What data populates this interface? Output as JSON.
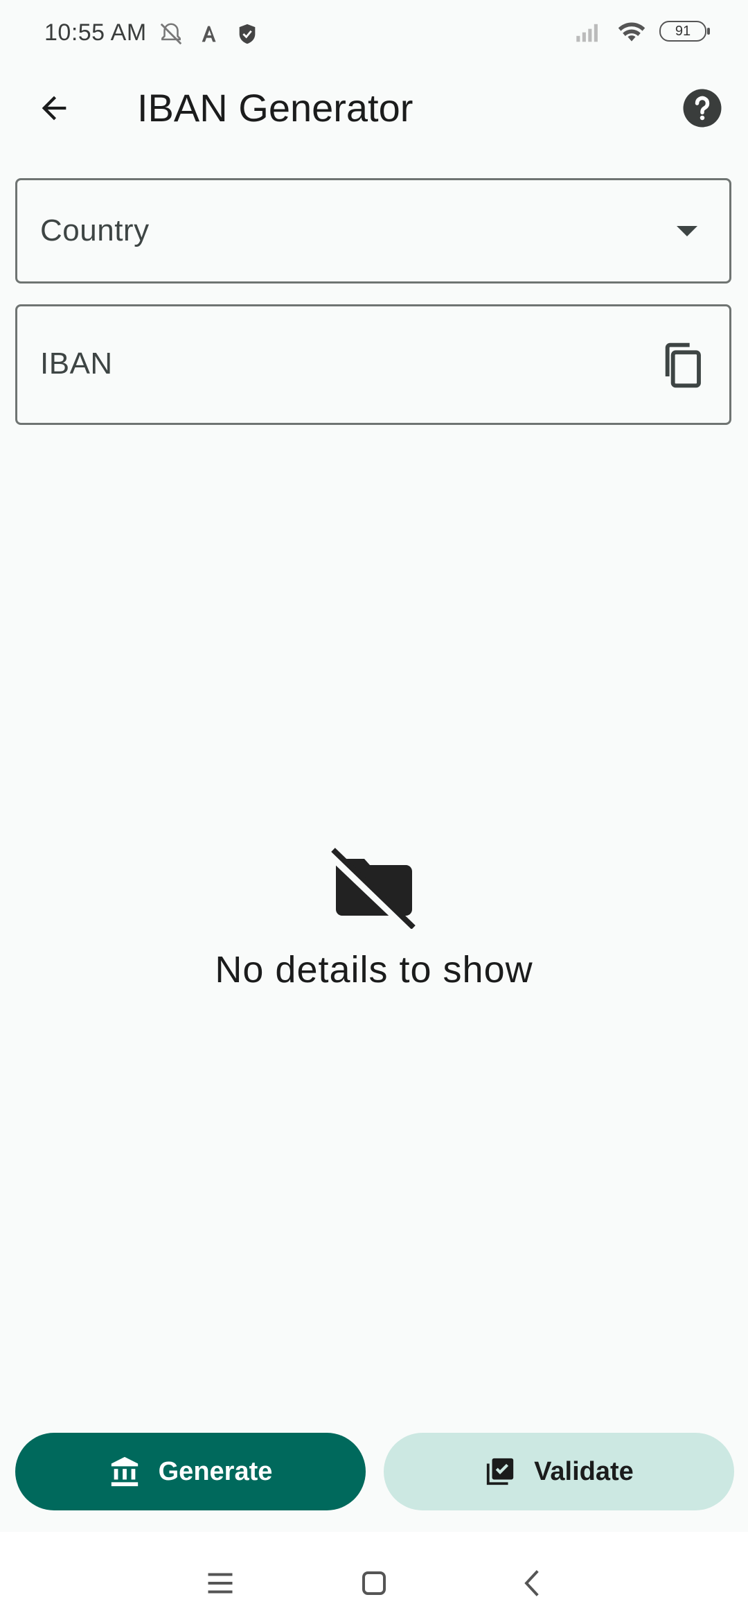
{
  "status_bar": {
    "time": "10:55 AM",
    "battery_level": "91",
    "left_icons": [
      "mute-bell-icon",
      "a-translate-icon",
      "shield-check-icon"
    ],
    "right_icons": [
      "signal-icon",
      "wifi-icon",
      "battery-icon"
    ]
  },
  "app_bar": {
    "title": "IBAN Generator",
    "back_icon": "arrow-left-icon",
    "help_icon": "help-circle-icon"
  },
  "form": {
    "country_label": "Country",
    "iban_label": "IBAN"
  },
  "empty_state": {
    "icon": "folder-off-icon",
    "message": "No details to show"
  },
  "actions": {
    "generate_label": "Generate",
    "validate_label": "Validate",
    "generate_icon": "bank-icon",
    "validate_icon": "library-add-check-icon"
  },
  "colors": {
    "primary": "#00695c",
    "primary_container": "#cce8e2",
    "background": "#f9fbfa"
  },
  "nav": {
    "items": [
      "menu-icon",
      "home-icon",
      "back-icon"
    ]
  }
}
